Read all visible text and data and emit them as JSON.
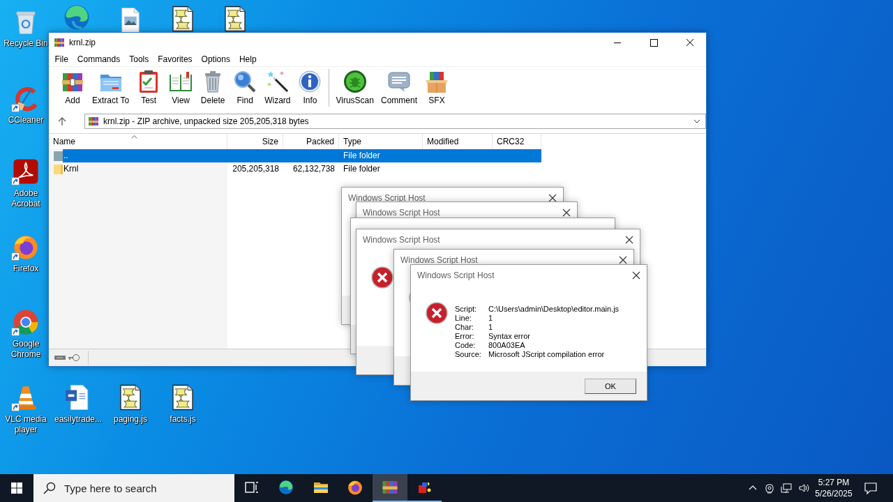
{
  "desktop_icons": [
    {
      "kind": "recycle-bin",
      "label": "Recycle Bin",
      "shortcut": false
    },
    {
      "kind": "edge",
      "shortcut": false
    },
    {
      "kind": "image-file",
      "shortcut": false
    },
    {
      "kind": "script",
      "shortcut": false
    },
    {
      "kind": "script",
      "shortcut": false
    },
    {
      "kind": "ccleaner",
      "label": "CCleaner",
      "shortcut": true
    },
    {
      "kind": "acrobat",
      "label": "Adobe Acrobat",
      "shortcut": true
    },
    {
      "kind": "firefox",
      "label": "Firefox",
      "shortcut": true
    },
    {
      "kind": "chrome",
      "label": "Google Chrome",
      "shortcut": true
    },
    {
      "kind": "vlc",
      "label": "VLC media player",
      "shortcut": true
    },
    {
      "kind": "word-doc",
      "label": "easilytrade...",
      "shortcut": false
    },
    {
      "kind": "script",
      "label": "paging.js",
      "shortcut": false
    },
    {
      "kind": "script",
      "label": "facts.js",
      "shortcut": false
    }
  ],
  "archive_window": {
    "title": "krnl.zip",
    "menu": [
      "File",
      "Commands",
      "Tools",
      "Favorites",
      "Options",
      "Help"
    ],
    "toolbar": [
      {
        "kind": "add",
        "label": "Add",
        "separator_before": false
      },
      {
        "kind": "extract",
        "label": "Extract To",
        "separator_before": false
      },
      {
        "kind": "test",
        "label": "Test",
        "separator_before": false
      },
      {
        "kind": "view",
        "label": "View",
        "separator_before": false
      },
      {
        "kind": "delete",
        "label": "Delete",
        "separator_before": false
      },
      {
        "kind": "find",
        "label": "Find",
        "separator_before": false
      },
      {
        "kind": "wizard",
        "label": "Wizard",
        "separator_before": false
      },
      {
        "kind": "info",
        "label": "Info",
        "separator_before": false
      },
      {
        "kind": "virusscan",
        "label": "VirusScan",
        "separator_before": true
      },
      {
        "kind": "comment",
        "label": "Comment",
        "separator_before": false
      },
      {
        "kind": "sfx",
        "label": "SFX",
        "separator_before": false
      }
    ],
    "address": "krnl.zip - ZIP archive, unpacked size 205,205,318 bytes",
    "columns": [
      "Name",
      "Size",
      "Packed",
      "Type",
      "Modified",
      "CRC32"
    ],
    "rows": [
      {
        "kind": "parent",
        "name": "..",
        "type": "File folder",
        "selected": true
      },
      {
        "kind": "folder",
        "name": "Krnl",
        "size": "205,205,318",
        "packed": "62,132,738",
        "type": "File folder",
        "selected": false
      }
    ]
  },
  "dialogs": [
    {
      "kind": "plain",
      "title": "Windows Script Host"
    },
    {
      "kind": "plain",
      "title": "Windows Script Host"
    },
    {
      "kind": "plain"
    },
    {
      "kind": "error",
      "title": "Windows Script Host"
    },
    {
      "kind": "error",
      "title": "Windows Script Host"
    },
    {
      "kind": "error",
      "title": "Windows Script Host",
      "fields": [
        {
          "label": "Script:",
          "value": "C:\\Users\\admin\\Desktop\\editor.main.js"
        },
        {
          "label": "Line:",
          "value": "1"
        },
        {
          "label": "Char:",
          "value": "1"
        },
        {
          "label": "Error:",
          "value": "Syntax error"
        },
        {
          "label": "Code:",
          "value": "800A03EA"
        },
        {
          "label": "Source:",
          "value": "Microsoft JScript compilation error"
        }
      ],
      "button": "OK"
    }
  ],
  "taskbar": {
    "search": {
      "placeholder": "Type here to search"
    },
    "apps": [
      {
        "kind": "task-view",
        "selected": false,
        "running": false
      },
      {
        "kind": "edge",
        "selected": false,
        "running": false
      },
      {
        "kind": "explorer",
        "selected": false,
        "running": false
      },
      {
        "kind": "firefox",
        "selected": false,
        "running": false
      },
      {
        "kind": "winrar",
        "selected": true,
        "running": true
      },
      {
        "kind": "app",
        "selected": false,
        "running": true
      }
    ],
    "clock": {
      "time": "5:27 PM",
      "date": "5/26/2025"
    }
  }
}
